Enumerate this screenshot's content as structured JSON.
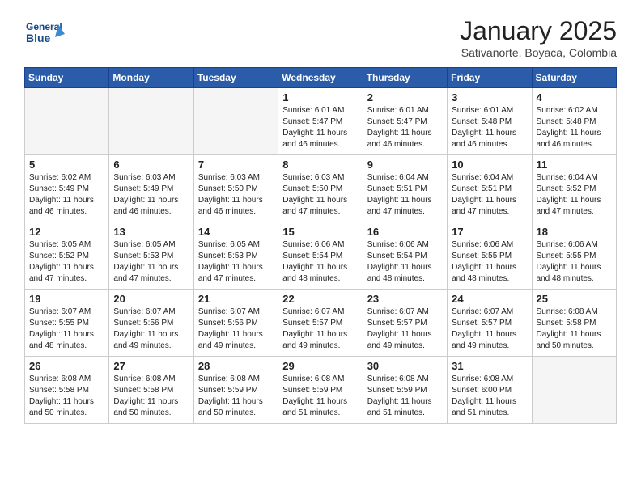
{
  "header": {
    "logo_line1": "General",
    "logo_line2": "Blue",
    "title": "January 2025",
    "subtitle": "Sativanorte, Boyaca, Colombia"
  },
  "days_of_week": [
    "Sunday",
    "Monday",
    "Tuesday",
    "Wednesday",
    "Thursday",
    "Friday",
    "Saturday"
  ],
  "weeks": [
    [
      {
        "day": "",
        "info": ""
      },
      {
        "day": "",
        "info": ""
      },
      {
        "day": "",
        "info": ""
      },
      {
        "day": "1",
        "info": "Sunrise: 6:01 AM\nSunset: 5:47 PM\nDaylight: 11 hours\nand 46 minutes."
      },
      {
        "day": "2",
        "info": "Sunrise: 6:01 AM\nSunset: 5:47 PM\nDaylight: 11 hours\nand 46 minutes."
      },
      {
        "day": "3",
        "info": "Sunrise: 6:01 AM\nSunset: 5:48 PM\nDaylight: 11 hours\nand 46 minutes."
      },
      {
        "day": "4",
        "info": "Sunrise: 6:02 AM\nSunset: 5:48 PM\nDaylight: 11 hours\nand 46 minutes."
      }
    ],
    [
      {
        "day": "5",
        "info": "Sunrise: 6:02 AM\nSunset: 5:49 PM\nDaylight: 11 hours\nand 46 minutes."
      },
      {
        "day": "6",
        "info": "Sunrise: 6:03 AM\nSunset: 5:49 PM\nDaylight: 11 hours\nand 46 minutes."
      },
      {
        "day": "7",
        "info": "Sunrise: 6:03 AM\nSunset: 5:50 PM\nDaylight: 11 hours\nand 46 minutes."
      },
      {
        "day": "8",
        "info": "Sunrise: 6:03 AM\nSunset: 5:50 PM\nDaylight: 11 hours\nand 47 minutes."
      },
      {
        "day": "9",
        "info": "Sunrise: 6:04 AM\nSunset: 5:51 PM\nDaylight: 11 hours\nand 47 minutes."
      },
      {
        "day": "10",
        "info": "Sunrise: 6:04 AM\nSunset: 5:51 PM\nDaylight: 11 hours\nand 47 minutes."
      },
      {
        "day": "11",
        "info": "Sunrise: 6:04 AM\nSunset: 5:52 PM\nDaylight: 11 hours\nand 47 minutes."
      }
    ],
    [
      {
        "day": "12",
        "info": "Sunrise: 6:05 AM\nSunset: 5:52 PM\nDaylight: 11 hours\nand 47 minutes."
      },
      {
        "day": "13",
        "info": "Sunrise: 6:05 AM\nSunset: 5:53 PM\nDaylight: 11 hours\nand 47 minutes."
      },
      {
        "day": "14",
        "info": "Sunrise: 6:05 AM\nSunset: 5:53 PM\nDaylight: 11 hours\nand 47 minutes."
      },
      {
        "day": "15",
        "info": "Sunrise: 6:06 AM\nSunset: 5:54 PM\nDaylight: 11 hours\nand 48 minutes."
      },
      {
        "day": "16",
        "info": "Sunrise: 6:06 AM\nSunset: 5:54 PM\nDaylight: 11 hours\nand 48 minutes."
      },
      {
        "day": "17",
        "info": "Sunrise: 6:06 AM\nSunset: 5:55 PM\nDaylight: 11 hours\nand 48 minutes."
      },
      {
        "day": "18",
        "info": "Sunrise: 6:06 AM\nSunset: 5:55 PM\nDaylight: 11 hours\nand 48 minutes."
      }
    ],
    [
      {
        "day": "19",
        "info": "Sunrise: 6:07 AM\nSunset: 5:55 PM\nDaylight: 11 hours\nand 48 minutes."
      },
      {
        "day": "20",
        "info": "Sunrise: 6:07 AM\nSunset: 5:56 PM\nDaylight: 11 hours\nand 49 minutes."
      },
      {
        "day": "21",
        "info": "Sunrise: 6:07 AM\nSunset: 5:56 PM\nDaylight: 11 hours\nand 49 minutes."
      },
      {
        "day": "22",
        "info": "Sunrise: 6:07 AM\nSunset: 5:57 PM\nDaylight: 11 hours\nand 49 minutes."
      },
      {
        "day": "23",
        "info": "Sunrise: 6:07 AM\nSunset: 5:57 PM\nDaylight: 11 hours\nand 49 minutes."
      },
      {
        "day": "24",
        "info": "Sunrise: 6:07 AM\nSunset: 5:57 PM\nDaylight: 11 hours\nand 49 minutes."
      },
      {
        "day": "25",
        "info": "Sunrise: 6:08 AM\nSunset: 5:58 PM\nDaylight: 11 hours\nand 50 minutes."
      }
    ],
    [
      {
        "day": "26",
        "info": "Sunrise: 6:08 AM\nSunset: 5:58 PM\nDaylight: 11 hours\nand 50 minutes."
      },
      {
        "day": "27",
        "info": "Sunrise: 6:08 AM\nSunset: 5:58 PM\nDaylight: 11 hours\nand 50 minutes."
      },
      {
        "day": "28",
        "info": "Sunrise: 6:08 AM\nSunset: 5:59 PM\nDaylight: 11 hours\nand 50 minutes."
      },
      {
        "day": "29",
        "info": "Sunrise: 6:08 AM\nSunset: 5:59 PM\nDaylight: 11 hours\nand 51 minutes."
      },
      {
        "day": "30",
        "info": "Sunrise: 6:08 AM\nSunset: 5:59 PM\nDaylight: 11 hours\nand 51 minutes."
      },
      {
        "day": "31",
        "info": "Sunrise: 6:08 AM\nSunset: 6:00 PM\nDaylight: 11 hours\nand 51 minutes."
      },
      {
        "day": "",
        "info": ""
      }
    ]
  ]
}
